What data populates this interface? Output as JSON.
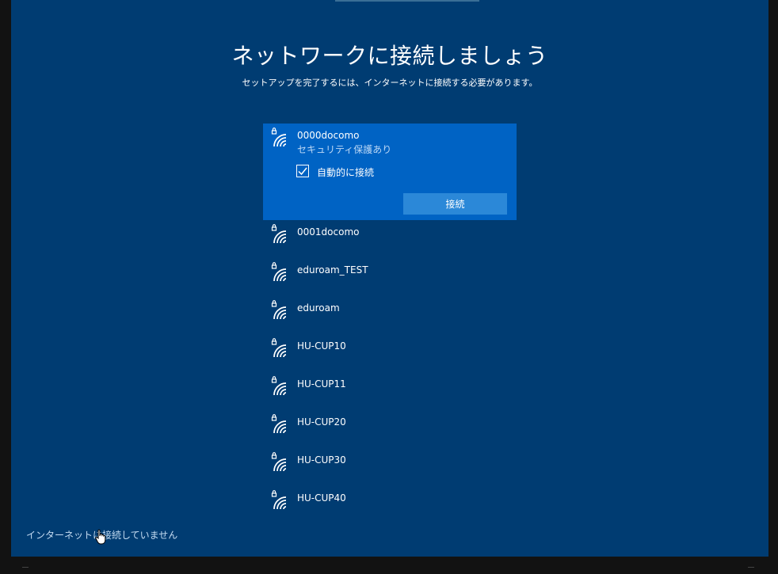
{
  "page": {
    "title": "ネットワークに接続しましょう",
    "subtitle": "セットアップを完了するには、インターネットに接続する必要があります。"
  },
  "selected_network": {
    "ssid": "0000docomo",
    "security": "セキュリティ保護あり",
    "auto_connect_label": "自動的に接続",
    "auto_connect_checked": true,
    "connect_label": "接続"
  },
  "networks": [
    {
      "ssid": "0001docomo"
    },
    {
      "ssid": "eduroam_TEST"
    },
    {
      "ssid": "eduroam"
    },
    {
      "ssid": "HU-CUP10"
    },
    {
      "ssid": "HU-CUP11"
    },
    {
      "ssid": "HU-CUP20"
    },
    {
      "ssid": "HU-CUP30"
    },
    {
      "ssid": "HU-CUP40"
    }
  ],
  "footer": {
    "no_internet_link": "インターネットに接続していません"
  },
  "icons": {
    "network": "secured-wifi-icon",
    "checkbox": "checkmark-icon",
    "pointer": "hand-cursor-icon"
  },
  "colors": {
    "background": "#003c72",
    "selected_row": "#0063c4",
    "button": "#2b88d8",
    "link": "#c5dcf2"
  }
}
